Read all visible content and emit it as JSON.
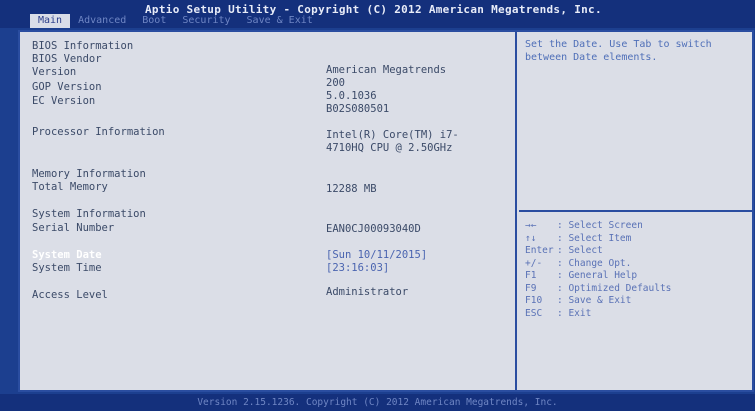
{
  "title": "Aptio Setup Utility - Copyright (C) 2012 American Megatrends, Inc.",
  "tabs": [
    "Main",
    "Advanced",
    "Boot",
    "Security",
    "Save & Exit"
  ],
  "main": {
    "bios_information": "BIOS Information",
    "bios_vendor_label": "BIOS Vendor",
    "bios_vendor_value": "American Megatrends",
    "version_label": "Version",
    "version_value": "200",
    "gop_version_label": "GOP Version",
    "gop_version_value": "5.0.1036",
    "ec_version_label": "EC Version",
    "ec_version_value": "B02S080501",
    "processor_information_label": "Processor Information",
    "processor_value_line1": "Intel(R) Core(TM) i7-",
    "processor_value_line2": "4710HQ CPU @ 2.50GHz",
    "memory_information": "Memory Information",
    "total_memory_label": "Total Memory",
    "total_memory_value": "12288 MB",
    "system_information": "System Information",
    "serial_number_label": "Serial Number",
    "serial_number_value": "EAN0CJ00093040D",
    "system_date_label": "System Date",
    "system_date_value": "[Sun 10/11/2015]",
    "system_time_label": "System Time",
    "system_time_value": "[23:16:03]",
    "access_level_label": "Access Level",
    "access_level_value": "Administrator"
  },
  "help_text": "Set the Date. Use Tab to switch between Date elements.",
  "keys": [
    {
      "key": "→←",
      "desc": ": Select Screen"
    },
    {
      "key": "↑↓",
      "desc": ": Select Item"
    },
    {
      "key": "Enter",
      "desc": ": Select"
    },
    {
      "key": "+/-",
      "desc": ": Change Opt."
    },
    {
      "key": "F1",
      "desc": ": General Help"
    },
    {
      "key": "F9",
      "desc": ": Optimized Defaults"
    },
    {
      "key": "F10",
      "desc": ": Save & Exit"
    },
    {
      "key": "ESC",
      "desc": ": Exit"
    }
  ],
  "footer": "Version 2.15.1236. Copyright (C) 2012 American Megatrends, Inc."
}
